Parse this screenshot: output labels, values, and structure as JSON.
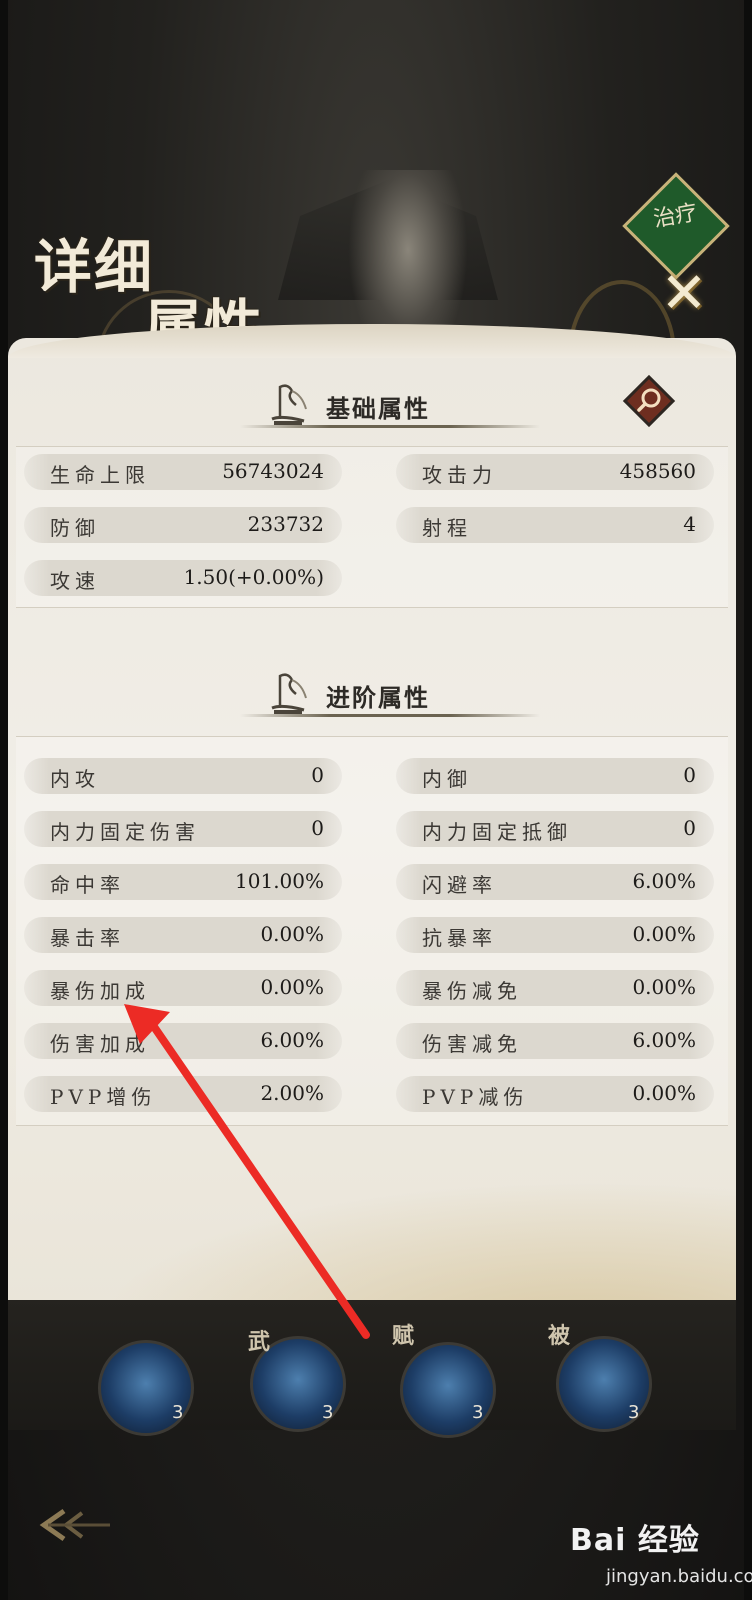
{
  "header": {
    "title_line1": "详细",
    "title_line2": "属性",
    "badge_text": "治疗",
    "close_label": "✕"
  },
  "basic": {
    "title": "基础属性",
    "stats": [
      {
        "label": "生命上限",
        "value": "56743024"
      },
      {
        "label": "攻击力",
        "value": "458560"
      },
      {
        "label": "防御",
        "value": "233732"
      },
      {
        "label": "射程",
        "value": "4"
      },
      {
        "label": "攻速",
        "value": "1.50(+0.00%)"
      }
    ]
  },
  "advanced": {
    "title": "进阶属性",
    "stats": [
      {
        "label": "内攻",
        "value": "0"
      },
      {
        "label": "内御",
        "value": "0"
      },
      {
        "label": "内力固定伤害",
        "value": "0"
      },
      {
        "label": "内力固定抵御",
        "value": "0"
      },
      {
        "label": "命中率",
        "value": "101.00%"
      },
      {
        "label": "闪避率",
        "value": "6.00%"
      },
      {
        "label": "暴击率",
        "value": "0.00%"
      },
      {
        "label": "抗暴率",
        "value": "0.00%"
      },
      {
        "label": "暴伤加成",
        "value": "0.00%"
      },
      {
        "label": "暴伤减免",
        "value": "0.00%"
      },
      {
        "label": "伤害加成",
        "value": "6.00%"
      },
      {
        "label": "伤害减免",
        "value": "6.00%"
      },
      {
        "label": "PVP增伤",
        "value": "2.00%"
      },
      {
        "label": "PVP减伤",
        "value": "0.00%"
      }
    ]
  },
  "tray": {
    "slots": [
      {
        "tag": "",
        "count": "3"
      },
      {
        "tag": "武",
        "count": "3"
      },
      {
        "tag": "赋",
        "count": "3"
      },
      {
        "tag": "被",
        "count": "3"
      }
    ]
  },
  "watermark": {
    "brand": "Bai 经验",
    "url": "jingyan.baidu.com"
  },
  "colors": {
    "arrow": "#ec2b25",
    "pill": "#dcd8cf",
    "panel": "#efebe3",
    "badge": "#1f5a2a"
  },
  "icons": [
    "brush-scroll-icon",
    "magnifier-icon",
    "close-icon",
    "back-arrow-icon",
    "skill-orb-icon"
  ]
}
